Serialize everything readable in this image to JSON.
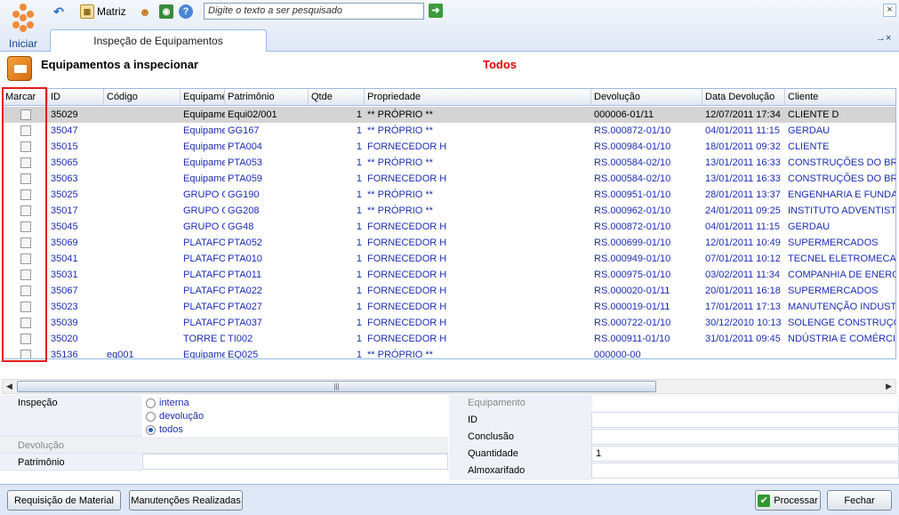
{
  "toolbar": {
    "start_label": "Iniciar",
    "matriz_label": "Matriz",
    "search_placeholder": "Digite o texto a ser pesquisado",
    "close_label": "×"
  },
  "tab": {
    "label": "Inspeção de Equipamentos",
    "scroll_label": "→×"
  },
  "page": {
    "title": "Equipamentos a inspecionar",
    "filter": "Todos",
    "filter_color": "#e00000"
  },
  "grid": {
    "columns": [
      "Marcar",
      "ID",
      "Código",
      "Equipame",
      "Patrimônio",
      "Qtde",
      "Propriedade",
      "Devolução",
      "Data Devolução",
      "Cliente"
    ],
    "rows": [
      {
        "id": "35029",
        "codigo": "",
        "equip": "Equipame",
        "patrimonio": "Equi02/001",
        "qtde": "1",
        "propriedade": "** PRÓPRIO **",
        "devolucao": "000006-01/11",
        "data": "12/07/2011 17:34",
        "cliente": "CLIENTE D"
      },
      {
        "id": "35047",
        "codigo": "",
        "equip": "Equipame",
        "patrimonio": "GG167",
        "qtde": "1",
        "propriedade": "** PRÓPRIO **",
        "devolucao": "RS.000872-01/10",
        "data": "04/01/2011 11:15",
        "cliente": "GERDAU"
      },
      {
        "id": "35015",
        "codigo": "",
        "equip": "Equipame",
        "patrimonio": "PTA004",
        "qtde": "1",
        "propriedade": "FORNECEDOR H",
        "devolucao": "RS.000984-01/10",
        "data": "18/01/2011 09:32",
        "cliente": "CLIENTE"
      },
      {
        "id": "35065",
        "codigo": "",
        "equip": "Equipame",
        "patrimonio": "PTA053",
        "qtde": "1",
        "propriedade": "** PRÓPRIO **",
        "devolucao": "RS.000584-02/10",
        "data": "13/01/2011 16:33",
        "cliente": "CONSTRUÇÕES DO BRASI"
      },
      {
        "id": "35063",
        "codigo": "",
        "equip": "Equipame",
        "patrimonio": "PTA059",
        "qtde": "1",
        "propriedade": "FORNECEDOR H",
        "devolucao": "RS.000584-02/10",
        "data": "13/01/2011 16:33",
        "cliente": "CONSTRUÇÕES DO BRASI"
      },
      {
        "id": "35025",
        "codigo": "",
        "equip": "GRUPO G",
        "patrimonio": "GG190",
        "qtde": "1",
        "propriedade": "** PRÓPRIO **",
        "devolucao": "RS.000951-01/10",
        "data": "28/01/2011 13:37",
        "cliente": "ENGENHARIA E FUNDAÇÃO"
      },
      {
        "id": "35017",
        "codigo": "",
        "equip": "GRUPO G",
        "patrimonio": "GG208",
        "qtde": "1",
        "propriedade": "** PRÓPRIO **",
        "devolucao": "RS.000962-01/10",
        "data": "24/01/2011 09:25",
        "cliente": "INSTITUTO ADVENTISTA S"
      },
      {
        "id": "35045",
        "codigo": "",
        "equip": "GRUPO G",
        "patrimonio": "GG48",
        "qtde": "1",
        "propriedade": "FORNECEDOR H",
        "devolucao": "RS.000872-01/10",
        "data": "04/01/2011 11:15",
        "cliente": "GERDAU"
      },
      {
        "id": "35069",
        "codigo": "",
        "equip": "PLATAFO",
        "patrimonio": "PTA052",
        "qtde": "1",
        "propriedade": "FORNECEDOR H",
        "devolucao": "RS.000699-01/10",
        "data": "12/01/2011 10:49",
        "cliente": "SUPERMERCADOS"
      },
      {
        "id": "35041",
        "codigo": "",
        "equip": "PLATAFO",
        "patrimonio": "PTA010",
        "qtde": "1",
        "propriedade": "FORNECEDOR H",
        "devolucao": "RS.000949-01/10",
        "data": "07/01/2011 10:12",
        "cliente": "TECNEL  ELETROMECANIC"
      },
      {
        "id": "35031",
        "codigo": "",
        "equip": "PLATAFO",
        "patrimonio": "PTA011",
        "qtde": "1",
        "propriedade": "FORNECEDOR H",
        "devolucao": "RS.000975-01/10",
        "data": "03/02/2011 11:34",
        "cliente": "COMPANHIA DE ENERGIA"
      },
      {
        "id": "35067",
        "codigo": "",
        "equip": "PLATAFO",
        "patrimonio": "PTA022",
        "qtde": "1",
        "propriedade": "FORNECEDOR H",
        "devolucao": "RS.000020-01/11",
        "data": "20/01/2011 16:18",
        "cliente": "SUPERMERCADOS"
      },
      {
        "id": "35023",
        "codigo": "",
        "equip": "PLATAFO",
        "patrimonio": "PTA027",
        "qtde": "1",
        "propriedade": "FORNECEDOR H",
        "devolucao": "RS.000019-01/11",
        "data": "17/01/2011 17:13",
        "cliente": "MANUTENÇÃO INDUSTRIA"
      },
      {
        "id": "35039",
        "codigo": "",
        "equip": "PLATAFO",
        "patrimonio": "PTA037",
        "qtde": "1",
        "propriedade": "FORNECEDOR H",
        "devolucao": "RS.000722-01/10",
        "data": "30/12/2010 10:13",
        "cliente": "SOLENGE CONSTRUÇÕES"
      },
      {
        "id": "35020",
        "codigo": "",
        "equip": "TORRE DI",
        "patrimonio": "TI002",
        "qtde": "1",
        "propriedade": "FORNECEDOR H",
        "devolucao": "RS.000911-01/10",
        "data": "31/01/2011 09:45",
        "cliente": "NDÚSTRIA E COMÉRCIO L"
      },
      {
        "id": "35136",
        "codigo": "eq001",
        "equip": "Equipame",
        "patrimonio": "EQ025",
        "qtde": "1",
        "propriedade": "** PRÓPRIO **",
        "devolucao": "000000-00",
        "data": "",
        "cliente": ""
      }
    ]
  },
  "form": {
    "inspecao_label": "Inspeção",
    "radio_interna": "interna",
    "radio_devolucao": "devolução",
    "radio_todos": "todos",
    "devolucao_label": "Devolução",
    "patrimonio_label": "Patrimônio",
    "equipamento_label": "Equipamento",
    "id_label": "ID",
    "conclusao_label": "Conclusão",
    "quantidade_label": "Quantidade",
    "quantidade_value": "1",
    "almoxarifado_label": "Almoxarifado"
  },
  "footer": {
    "req_material": "Requisição de Material",
    "manutencoes": "Manutenções Realizadas",
    "processar": "Processar",
    "fechar": "Fechar"
  }
}
